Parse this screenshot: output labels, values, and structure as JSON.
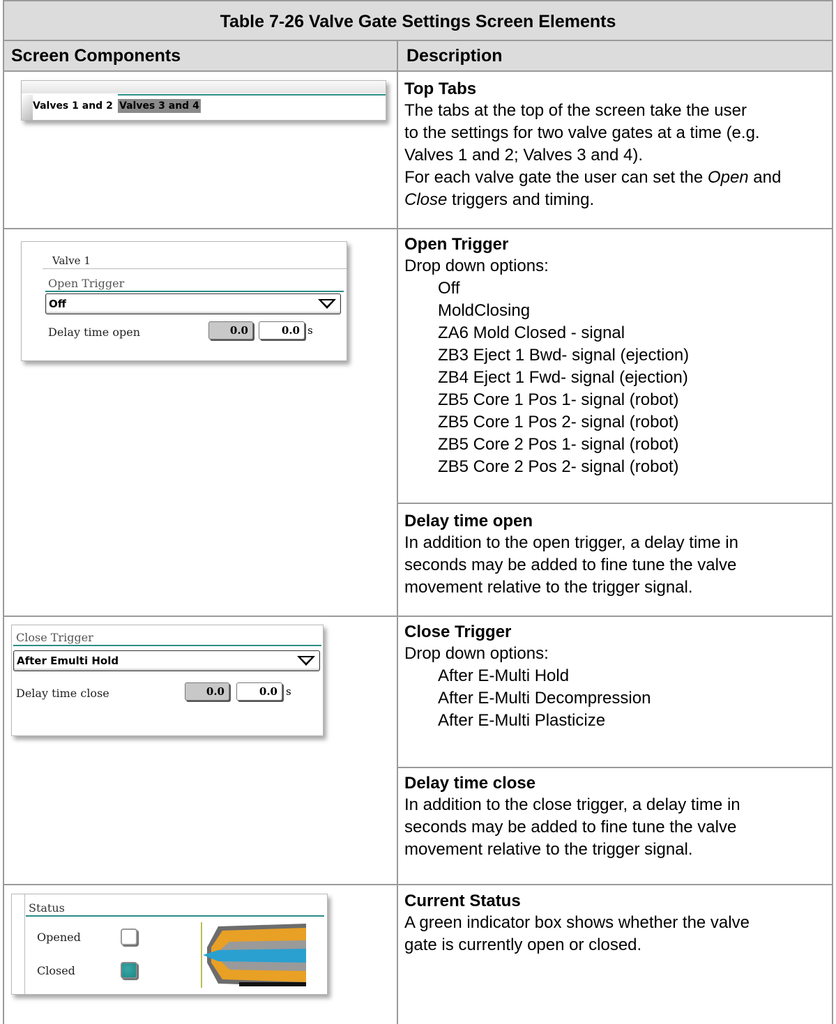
{
  "table": {
    "title": "Table 7-26 Valve Gate Settings Screen Elements",
    "col1_header": "Screen Components",
    "col2_header": "Description"
  },
  "tabs_shot": {
    "tab1": "Valves 1 and 2",
    "tab2": "Valves 3 and 4"
  },
  "open_shot": {
    "heading": "Valve 1",
    "section_label": "Open Trigger",
    "dropdown_value": "Off",
    "delay_label": "Delay time open",
    "value_actual": "0.0",
    "value_set": "0.0",
    "unit": "s"
  },
  "close_shot": {
    "section_label": "Close Trigger",
    "dropdown_value": "After Emulti Hold",
    "delay_label": "Delay time close",
    "value_actual": "0.0",
    "value_set": "0.0",
    "unit": "s"
  },
  "status_shot": {
    "section_label": "Status",
    "opened_label": "Opened",
    "closed_label": "Closed",
    "opened_state": "off",
    "closed_state": "on",
    "indicator_color": "#1a8a8a"
  },
  "rows": {
    "top_tabs": {
      "heading": "Top Tabs",
      "line1": "The tabs at the top of the screen take the user",
      "line2": "to the settings for two valve gates at a time (e.g.",
      "line3": "Valves 1 and 2; Valves 3 and 4).",
      "line4a": "For each valve gate the user can set the ",
      "line4_italic": "Open",
      "line4b": " and",
      "line5_italic": "Close",
      "line5b": " triggers and timing."
    },
    "open_trigger": {
      "heading": "Open Trigger",
      "intro": "Drop down options:",
      "options": [
        "Off",
        "MoldClosing",
        "ZA6 Mold Closed - signal",
        "ZB3 Eject 1 Bwd- signal (ejection)",
        "ZB4 Eject 1 Fwd- signal (ejection)",
        "ZB5 Core 1 Pos 1- signal (robot)",
        "ZB5 Core 1 Pos 2- signal (robot)",
        "ZB5 Core 2 Pos 1- signal (robot)",
        "ZB5 Core 2 Pos 2- signal (robot)"
      ]
    },
    "delay_open": {
      "heading": "Delay time open",
      "line1": "In addition to the open trigger, a delay time in",
      "line2": "seconds may be added to fine tune the valve",
      "line3": "movement relative to the trigger signal."
    },
    "close_trigger": {
      "heading": "Close Trigger",
      "intro": "Drop down options:",
      "options": [
        "After E-Multi Hold",
        "After E-Multi Decompression",
        "After E-Multi Plasticize"
      ]
    },
    "delay_close": {
      "heading": "Delay time close",
      "line1": "In addition to the close trigger, a delay time in",
      "line2": "seconds may be added to fine tune the valve",
      "line3": "movement relative to the trigger signal."
    },
    "current_status": {
      "heading": "Current Status",
      "line1": "A green indicator box shows whether the valve",
      "line2": "gate is currently open or closed."
    }
  }
}
